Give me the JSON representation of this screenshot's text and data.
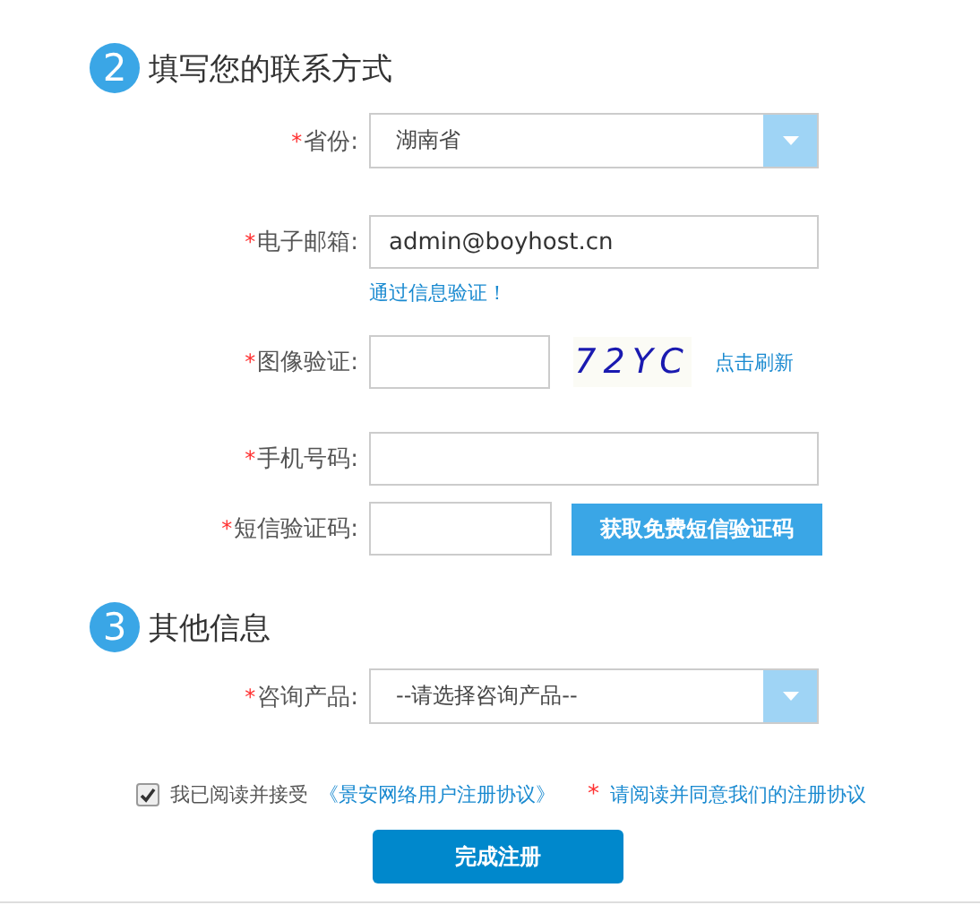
{
  "sections": [
    {
      "number": "2",
      "title": "填写您的联系方式",
      "fields": [
        {
          "kind": "select",
          "required": true,
          "label": "省份:",
          "value": "湖南省"
        },
        {
          "kind": "input",
          "required": true,
          "label": "电子邮箱:",
          "value": "admin@boyhost.cn",
          "hint": "通过信息验证！"
        },
        {
          "kind": "captcha",
          "required": true,
          "label": "图像验证:",
          "captcha": "72YC",
          "refresh": "点击刷新"
        },
        {
          "kind": "input",
          "required": true,
          "label": "手机号码:"
        },
        {
          "kind": "sms",
          "required": true,
          "label": "短信验证码:",
          "button": "获取免费短信验证码"
        }
      ]
    },
    {
      "number": "3",
      "title": "其他信息",
      "fields": [
        {
          "kind": "select",
          "required": true,
          "label": "咨询产品:",
          "value": "--请选择咨询产品--"
        }
      ]
    }
  ],
  "agreement": {
    "checked": true,
    "text": "我已阅读并接受",
    "link": "《景安网络用户注册协议》",
    "mark": "*",
    "notice": "请阅读并同意我们的注册协议"
  },
  "submit": "完成注册"
}
